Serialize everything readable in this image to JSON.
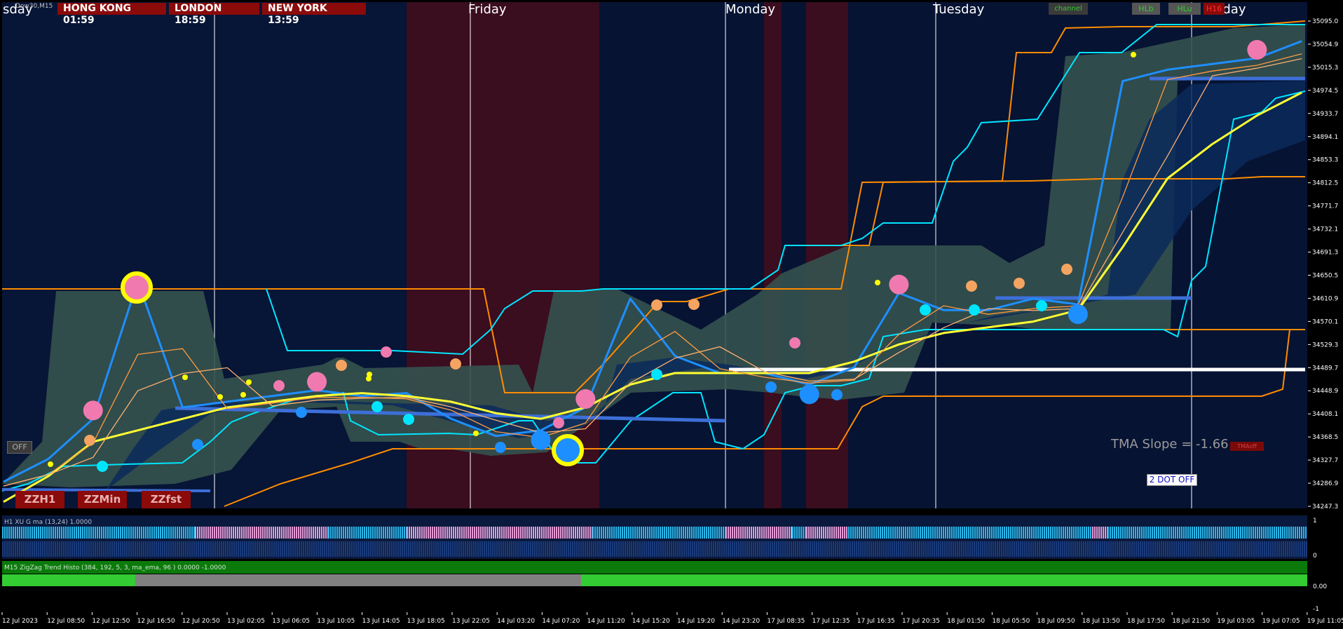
{
  "symbol_label": "Dow30,M15",
  "clocks": [
    {
      "label": "HONG KONG 01:59"
    },
    {
      "label": "LONDON  18:59"
    },
    {
      "label": "NEW YORK 13:59"
    }
  ],
  "day_labels": [
    "sday",
    "Friday",
    "Monday",
    "Tuesday",
    "sday"
  ],
  "top_buttons": {
    "channel": "channel",
    "hlb": "HLb",
    "hlu": "HLu",
    "h16": "H16"
  },
  "zz_buttons": [
    "ZZH1",
    "ZZMin",
    "ZZfst"
  ],
  "off_button": "OFF",
  "tma_slope": {
    "label": "TMA Slope = -1.66",
    "badge": "TMAoff"
  },
  "dot_button": "2 DOT OFF",
  "subwindow1": {
    "title": "H1 XU G ma (13,24) 1.0000",
    "scale": [
      "1",
      "0"
    ]
  },
  "subwindow2": {
    "title": "M15 ZigZag Trend Histo (384, 192, 5, 3, ma_ema, 96 ) 0.0000 -1.0000",
    "scale": [
      "0.00",
      "-1"
    ]
  },
  "colors": {
    "background": "#061333",
    "session_red": "#3a0d1f",
    "session_navy": "#0a1a3e",
    "channel_fill": "#35524e",
    "price_blue": "#1e8fff",
    "orange_band": "#ff8c00",
    "cyan_band": "#00e5ff",
    "ma_yellow": "#ffff33",
    "histo_up": "#29b6e8",
    "histo_down": "#e69ad6",
    "trend_up": "#33cc33",
    "trend_down": "#808080"
  },
  "chart_data": {
    "type": "line",
    "title": "",
    "x": [
      "12 Jul 2023",
      "12 Jul 08:50",
      "12 Jul 12:50",
      "12 Jul 16:50",
      "12 Jul 20:50",
      "13 Jul 02:05",
      "13 Jul 06:05",
      "13 Jul 10:05",
      "13 Jul 14:05",
      "13 Jul 18:05",
      "13 Jul 22:05",
      "14 Jul 03:20",
      "14 Jul 07:20",
      "14 Jul 11:20",
      "14 Jul 15:20",
      "14 Jul 19:20",
      "14 Jul 23:20",
      "17 Jul 08:35",
      "17 Jul 12:35",
      "17 Jul 16:35",
      "17 Jul 20:35",
      "18 Jul 01:50",
      "18 Jul 05:50",
      "18 Jul 09:50",
      "18 Jul 13:50",
      "18 Jul 17:50",
      "18 Jul 21:50",
      "19 Jul 03:05",
      "19 Jul 07:05",
      "19 Jul 11:05"
    ],
    "y_ticks": [
      "35095.0",
      "35054.9",
      "35015.3",
      "34974.5",
      "34933.7",
      "34894.1",
      "34853.3",
      "34812.5",
      "34771.7",
      "34732.1",
      "34691.3",
      "34650.5",
      "34610.9",
      "34570.1",
      "34529.3",
      "34489.7",
      "34448.9",
      "34408.1",
      "34368.5",
      "34327.7",
      "34286.9",
      "34247.3"
    ],
    "ylim": [
      34247.3,
      35095.0
    ],
    "grid": false,
    "series": [
      {
        "values": [
          34290,
          34330,
          34400,
          34640,
          34420,
          34430,
          34440,
          34450,
          34440,
          34445,
          34400,
          34370,
          34380,
          34420,
          34610,
          34510,
          34480,
          34480,
          34460,
          34490,
          34620,
          34590,
          34590,
          34610,
          34600,
          34990,
          35010,
          35020,
          35030,
          35060
        ]
      },
      {
        "values": [
          34255,
          34300,
          34360,
          34380,
          34400,
          34420,
          34430,
          34440,
          34445,
          34440,
          34430,
          34410,
          34400,
          34420,
          34460,
          34480,
          34480,
          34480,
          34480,
          34500,
          34530,
          34550,
          34560,
          34570,
          34590,
          34700,
          34820,
          34880,
          34930,
          34970
        ]
      },
      {
        "values": [
          34650,
          34650,
          34650,
          34650,
          34650,
          34650,
          34650,
          34650,
          34650,
          34650,
          34360,
          34360,
          34360,
          34360,
          34710,
          34710,
          34710,
          34710,
          34710,
          34710,
          35040,
          35040,
          35040,
          35040,
          35040,
          35070,
          35070,
          35070,
          35070,
          35070
        ]
      }
    ],
    "signals": [
      {
        "x": "12 Jul 12:50",
        "type": "pink-top"
      },
      {
        "x": "13 Jul 10:05",
        "type": "pink-top"
      },
      {
        "x": "14 Jul 07:20",
        "type": "blue-bottom"
      },
      {
        "x": "14 Jul 11:20",
        "type": "pink-top"
      },
      {
        "x": "17 Jul 20:35",
        "type": "pink-top"
      },
      {
        "x": "17 Jul 12:35",
        "type": "blue-bottom"
      },
      {
        "x": "18 Jul 13:50",
        "type": "blue-bottom"
      },
      {
        "x": "19 Jul 07:05",
        "type": "pink-top"
      }
    ]
  }
}
